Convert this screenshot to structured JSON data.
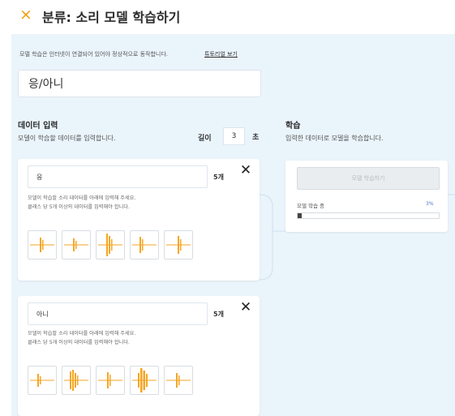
{
  "header": {
    "title": "분류: 소리 모델 학습하기",
    "close_icon": "×"
  },
  "notice": {
    "text": "모델 학습은 인터넷이 연결되어 있어야 정상적으로 동작합니다.",
    "tutorial_link": "튜토리얼 보기"
  },
  "model_title": {
    "value": "응/아니"
  },
  "data_input": {
    "title": "데이터 입력",
    "description": "모델이 학습할 데이터를 입력합니다.",
    "length_label": "길이",
    "length_value": "3",
    "length_unit": "초"
  },
  "classes": [
    {
      "name": "응",
      "count": "5개",
      "delete_icon": "✕",
      "description_line1": "모델이 학습할 소리 데이터를 아래에 입력해 주세요.",
      "description_line2": "클래스 당 5개 이상의 데이터를 입력해야 합니다.",
      "sample_count": 5
    },
    {
      "name": "아니",
      "count": "5개",
      "delete_icon": "✕",
      "description_line1": "모델이 학습할 소리 데이터를 아래에 입력해 주세요.",
      "description_line2": "클래스 당 5개 이상의 데이터를 입력해야 합니다.",
      "sample_count": 5
    }
  ],
  "training": {
    "title": "학습",
    "description": "입력한 데이터로 모델을 학습합니다.",
    "button_label": "모델 학습하기",
    "status": "모델 학습 중",
    "percent": "3%",
    "progress_fraction": 0.03
  },
  "colors": {
    "accent": "#f39c12",
    "waveform": "#f5a623",
    "panel_bg": "#eaf4fb",
    "progress_text": "#4a78c4"
  }
}
